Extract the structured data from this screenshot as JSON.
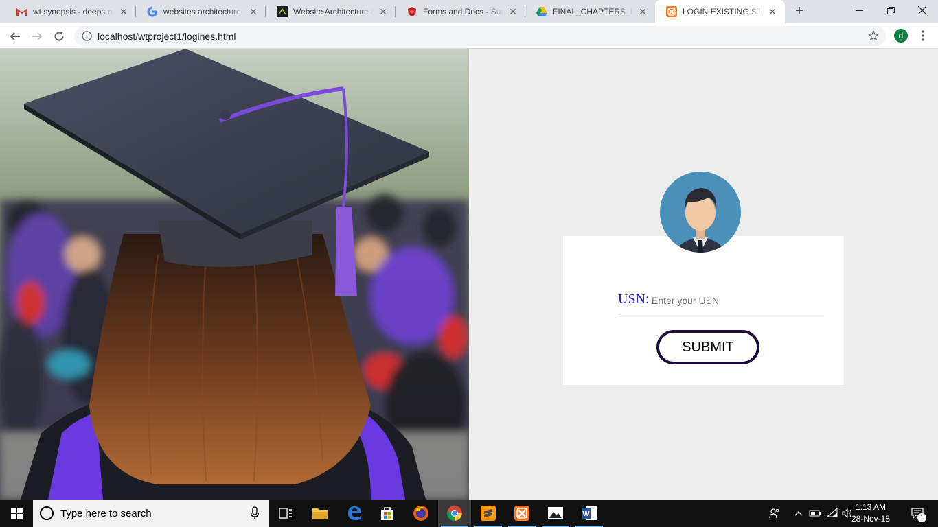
{
  "browser": {
    "tabs": [
      {
        "title": "wt synopsis - deeps.nag",
        "favicon": "gmail-icon"
      },
      {
        "title": "websites architecture - ",
        "favicon": "google-icon"
      },
      {
        "title": "Website Architecture &",
        "favicon": "site-icon"
      },
      {
        "title": "Forms and Docs - Suma",
        "favicon": "forms-icon"
      },
      {
        "title": "FINAL_CHAPTERS_PAGE",
        "favicon": "drive-icon"
      },
      {
        "title": "LOGIN EXISTING STUDE",
        "favicon": "xampp-icon",
        "active": true
      }
    ],
    "url": "localhost/wtproject1/logines.html",
    "profile_initial": "d"
  },
  "login": {
    "usn_label": "USN:",
    "usn_placeholder": "Enter your USN",
    "usn_value": "",
    "submit_label": "SUBMIT"
  },
  "taskbar": {
    "search_placeholder": "Type here to search",
    "apps": [
      "task-view-icon",
      "file-explorer-icon",
      "edge-icon",
      "store-icon",
      "firefox-icon",
      "chrome-icon",
      "sublime-icon",
      "xampp-icon",
      "photos-icon",
      "word-icon"
    ],
    "time": "1:13 AM",
    "date": "28-Nov-18",
    "notification_count": "1"
  },
  "colors": {
    "accent": "#1a1ad6",
    "button_border": "#1a0a3a",
    "page_bg": "#ededed",
    "avatar_bg": "#4a90b8"
  }
}
